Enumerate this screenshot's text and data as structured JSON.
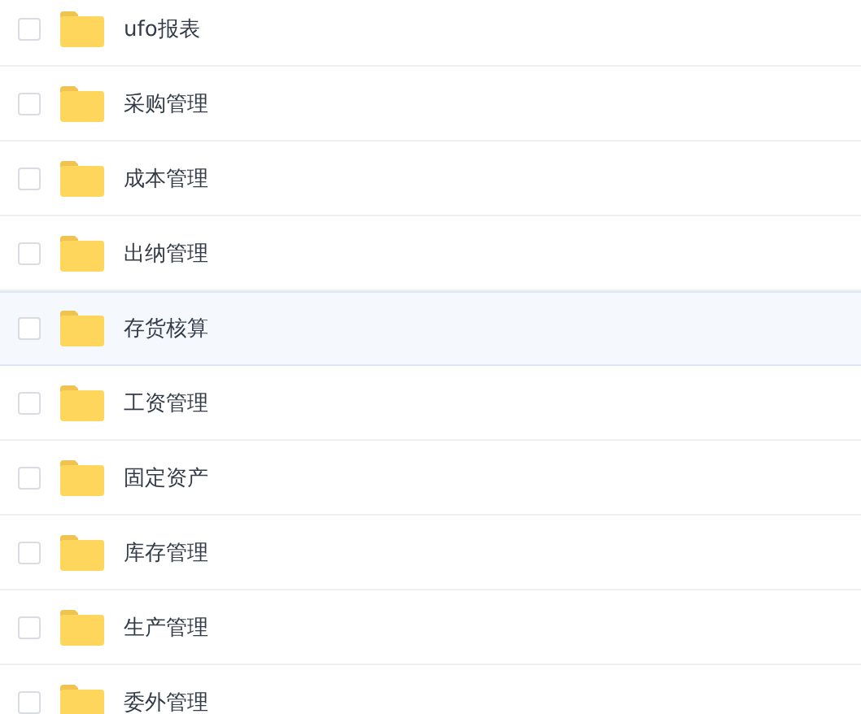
{
  "files": [
    {
      "name": "ufo报表",
      "checked": false,
      "selected": false
    },
    {
      "name": "采购管理",
      "checked": false,
      "selected": false
    },
    {
      "name": "成本管理",
      "checked": false,
      "selected": false
    },
    {
      "name": "出纳管理",
      "checked": false,
      "selected": false
    },
    {
      "name": "存货核算",
      "checked": false,
      "selected": true
    },
    {
      "name": "工资管理",
      "checked": false,
      "selected": false
    },
    {
      "name": "固定资产",
      "checked": false,
      "selected": false
    },
    {
      "name": "库存管理",
      "checked": false,
      "selected": false
    },
    {
      "name": "生产管理",
      "checked": false,
      "selected": false
    },
    {
      "name": "委外管理",
      "checked": false,
      "selected": false
    }
  ]
}
